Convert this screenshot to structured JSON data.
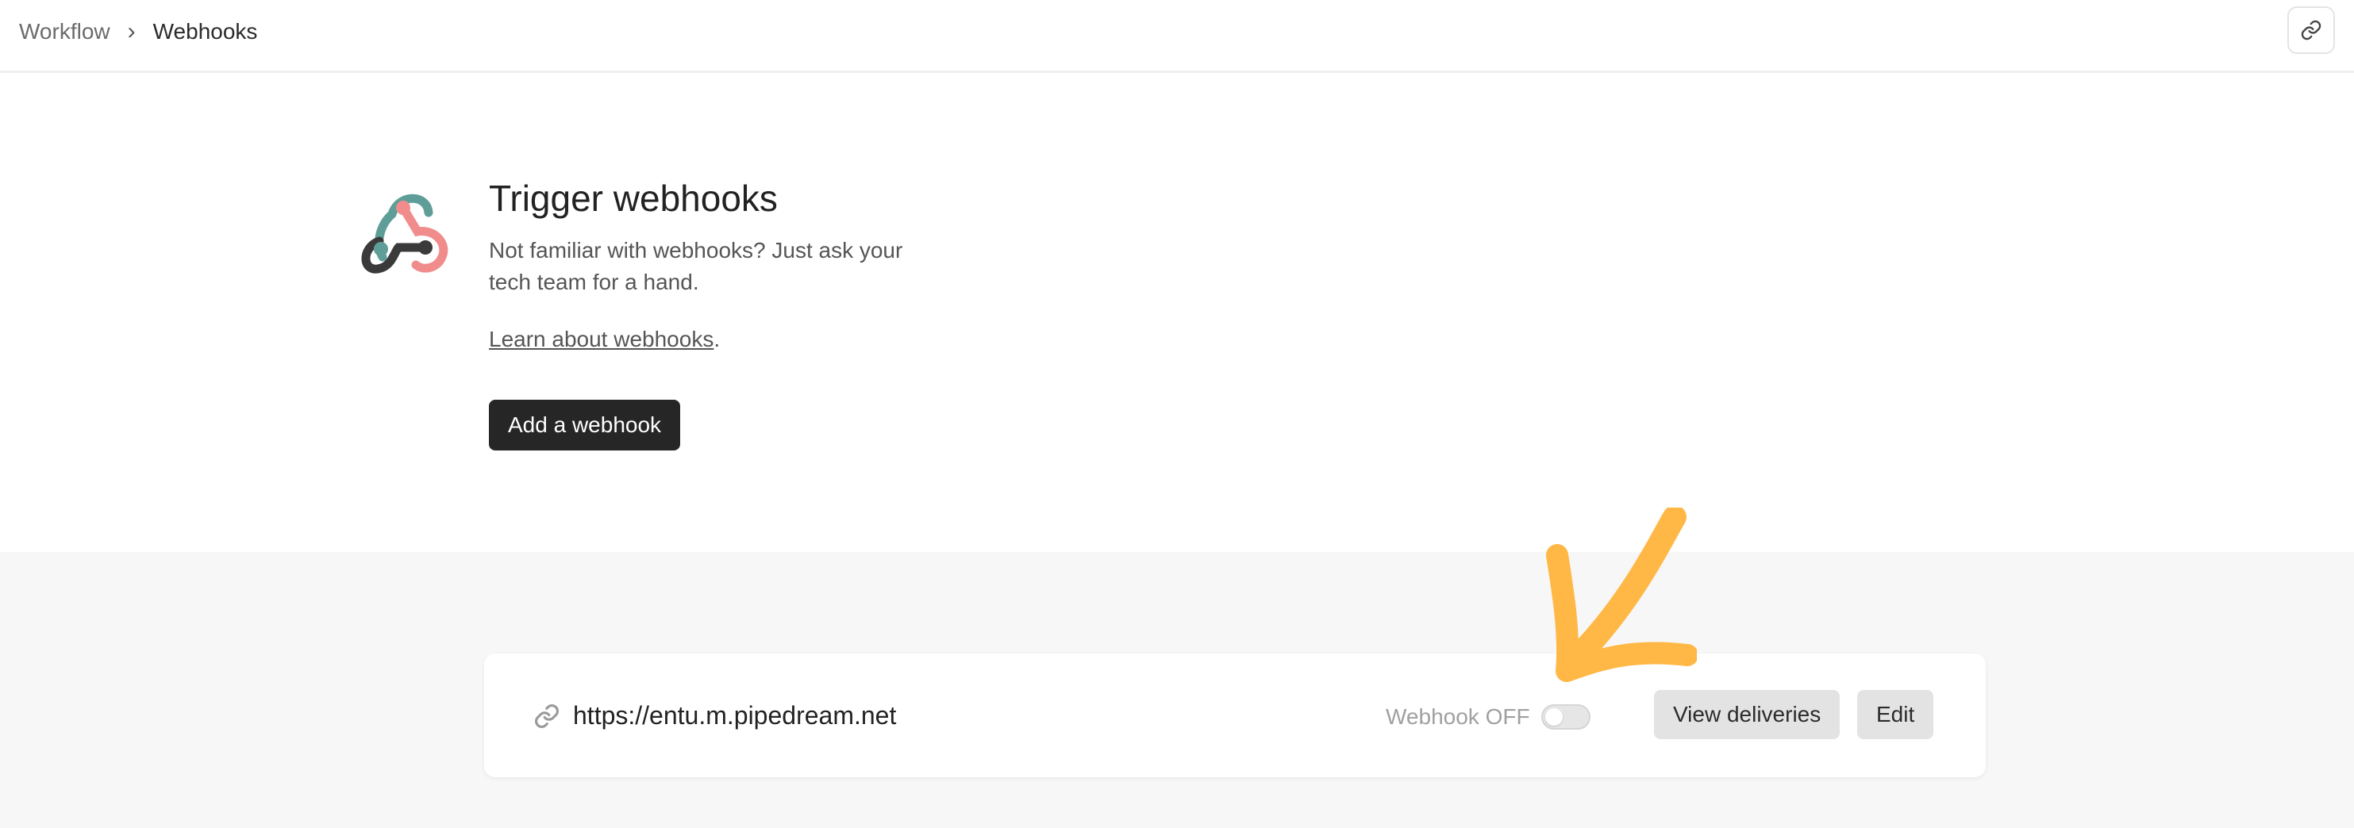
{
  "breadcrumb": {
    "parent": "Workflow",
    "separator": "›",
    "current": "Webhooks"
  },
  "header": {
    "copy_link_icon": "link-icon"
  },
  "intro": {
    "title": "Trigger webhooks",
    "description": "Not familiar with webhooks? Just ask your tech team for a hand.",
    "learn_link": "Learn about webhooks",
    "learn_suffix": ".",
    "add_button": "Add a webhook"
  },
  "webhook": {
    "url": "https://entu.m.pipedream.net",
    "status_label": "Webhook OFF",
    "enabled": false,
    "view_deliveries": "View deliveries",
    "edit": "Edit"
  },
  "colors": {
    "accent_arrow": "#FFB845",
    "primary_button": "#262626",
    "lower_background": "#F7F7F7",
    "logo_teal": "#5F9E98",
    "logo_pink": "#F08C8C",
    "logo_dark": "#3A3A3A"
  }
}
